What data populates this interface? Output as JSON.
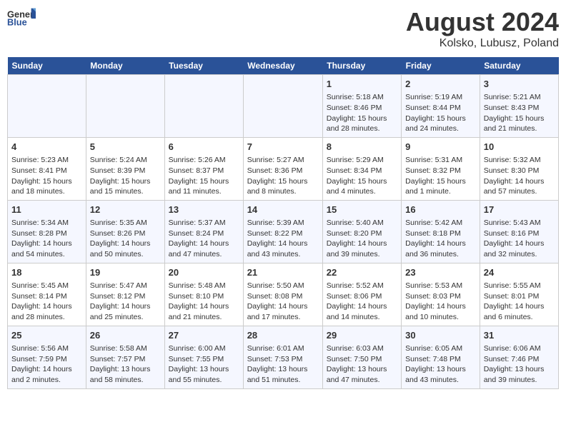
{
  "header": {
    "logo_general": "General",
    "logo_blue": "Blue",
    "title": "August 2024",
    "subtitle": "Kolsko, Lubusz, Poland"
  },
  "days_of_week": [
    "Sunday",
    "Monday",
    "Tuesday",
    "Wednesday",
    "Thursday",
    "Friday",
    "Saturday"
  ],
  "weeks": [
    {
      "days": [
        {
          "num": "",
          "text": ""
        },
        {
          "num": "",
          "text": ""
        },
        {
          "num": "",
          "text": ""
        },
        {
          "num": "",
          "text": ""
        },
        {
          "num": "1",
          "text": "Sunrise: 5:18 AM\nSunset: 8:46 PM\nDaylight: 15 hours\nand 28 minutes."
        },
        {
          "num": "2",
          "text": "Sunrise: 5:19 AM\nSunset: 8:44 PM\nDaylight: 15 hours\nand 24 minutes."
        },
        {
          "num": "3",
          "text": "Sunrise: 5:21 AM\nSunset: 8:43 PM\nDaylight: 15 hours\nand 21 minutes."
        }
      ]
    },
    {
      "days": [
        {
          "num": "4",
          "text": "Sunrise: 5:23 AM\nSunset: 8:41 PM\nDaylight: 15 hours\nand 18 minutes."
        },
        {
          "num": "5",
          "text": "Sunrise: 5:24 AM\nSunset: 8:39 PM\nDaylight: 15 hours\nand 15 minutes."
        },
        {
          "num": "6",
          "text": "Sunrise: 5:26 AM\nSunset: 8:37 PM\nDaylight: 15 hours\nand 11 minutes."
        },
        {
          "num": "7",
          "text": "Sunrise: 5:27 AM\nSunset: 8:36 PM\nDaylight: 15 hours\nand 8 minutes."
        },
        {
          "num": "8",
          "text": "Sunrise: 5:29 AM\nSunset: 8:34 PM\nDaylight: 15 hours\nand 4 minutes."
        },
        {
          "num": "9",
          "text": "Sunrise: 5:31 AM\nSunset: 8:32 PM\nDaylight: 15 hours\nand 1 minute."
        },
        {
          "num": "10",
          "text": "Sunrise: 5:32 AM\nSunset: 8:30 PM\nDaylight: 14 hours\nand 57 minutes."
        }
      ]
    },
    {
      "days": [
        {
          "num": "11",
          "text": "Sunrise: 5:34 AM\nSunset: 8:28 PM\nDaylight: 14 hours\nand 54 minutes."
        },
        {
          "num": "12",
          "text": "Sunrise: 5:35 AM\nSunset: 8:26 PM\nDaylight: 14 hours\nand 50 minutes."
        },
        {
          "num": "13",
          "text": "Sunrise: 5:37 AM\nSunset: 8:24 PM\nDaylight: 14 hours\nand 47 minutes."
        },
        {
          "num": "14",
          "text": "Sunrise: 5:39 AM\nSunset: 8:22 PM\nDaylight: 14 hours\nand 43 minutes."
        },
        {
          "num": "15",
          "text": "Sunrise: 5:40 AM\nSunset: 8:20 PM\nDaylight: 14 hours\nand 39 minutes."
        },
        {
          "num": "16",
          "text": "Sunrise: 5:42 AM\nSunset: 8:18 PM\nDaylight: 14 hours\nand 36 minutes."
        },
        {
          "num": "17",
          "text": "Sunrise: 5:43 AM\nSunset: 8:16 PM\nDaylight: 14 hours\nand 32 minutes."
        }
      ]
    },
    {
      "days": [
        {
          "num": "18",
          "text": "Sunrise: 5:45 AM\nSunset: 8:14 PM\nDaylight: 14 hours\nand 28 minutes."
        },
        {
          "num": "19",
          "text": "Sunrise: 5:47 AM\nSunset: 8:12 PM\nDaylight: 14 hours\nand 25 minutes."
        },
        {
          "num": "20",
          "text": "Sunrise: 5:48 AM\nSunset: 8:10 PM\nDaylight: 14 hours\nand 21 minutes."
        },
        {
          "num": "21",
          "text": "Sunrise: 5:50 AM\nSunset: 8:08 PM\nDaylight: 14 hours\nand 17 minutes."
        },
        {
          "num": "22",
          "text": "Sunrise: 5:52 AM\nSunset: 8:06 PM\nDaylight: 14 hours\nand 14 minutes."
        },
        {
          "num": "23",
          "text": "Sunrise: 5:53 AM\nSunset: 8:03 PM\nDaylight: 14 hours\nand 10 minutes."
        },
        {
          "num": "24",
          "text": "Sunrise: 5:55 AM\nSunset: 8:01 PM\nDaylight: 14 hours\nand 6 minutes."
        }
      ]
    },
    {
      "days": [
        {
          "num": "25",
          "text": "Sunrise: 5:56 AM\nSunset: 7:59 PM\nDaylight: 14 hours\nand 2 minutes."
        },
        {
          "num": "26",
          "text": "Sunrise: 5:58 AM\nSunset: 7:57 PM\nDaylight: 13 hours\nand 58 minutes."
        },
        {
          "num": "27",
          "text": "Sunrise: 6:00 AM\nSunset: 7:55 PM\nDaylight: 13 hours\nand 55 minutes."
        },
        {
          "num": "28",
          "text": "Sunrise: 6:01 AM\nSunset: 7:53 PM\nDaylight: 13 hours\nand 51 minutes."
        },
        {
          "num": "29",
          "text": "Sunrise: 6:03 AM\nSunset: 7:50 PM\nDaylight: 13 hours\nand 47 minutes."
        },
        {
          "num": "30",
          "text": "Sunrise: 6:05 AM\nSunset: 7:48 PM\nDaylight: 13 hours\nand 43 minutes."
        },
        {
          "num": "31",
          "text": "Sunrise: 6:06 AM\nSunset: 7:46 PM\nDaylight: 13 hours\nand 39 minutes."
        }
      ]
    }
  ]
}
